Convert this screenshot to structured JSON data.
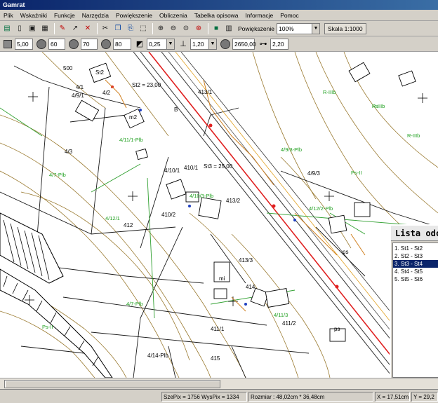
{
  "window": {
    "title": "Gamrat"
  },
  "menu": [
    "Plik",
    "Wskaźniki",
    "Funkcje",
    "Narzędzia",
    "Powiększenie",
    "Obliczenia",
    "Tabelka opisowa",
    "Informacje",
    "Pomoc"
  ],
  "toolbar1": {
    "zoom_label": "Powiększenie",
    "zoom_value": "100%",
    "scale_button": "Skala 1:1000"
  },
  "toolbar2": {
    "f1": "5,00",
    "f2": "60",
    "f3": "70",
    "f4": "80",
    "f5": "0,25",
    "f6": "1,20",
    "f7": "2650,00",
    "f8": "2,20"
  },
  "map_labels": [
    "500",
    "4/1",
    "St2",
    "St2 = 23,00",
    "m2",
    "4/2",
    "4/3",
    "4/10/1",
    "4/9/1",
    "4/9/3",
    "410/1",
    "410/2",
    "411/1",
    "411/2",
    "412",
    "413/1",
    "413/2",
    "413/3",
    "414",
    "415",
    "St3 = 25,00",
    "4/11/1-Plb",
    "4/10/3-Plb",
    "4/9/3-Plb",
    "Ps-II",
    "Ps",
    "ps",
    "4/12/1",
    "4/12/2-Plb",
    "4/11/3",
    "4/14-Plb",
    "4/7-Plb",
    "R-IIIb",
    "B",
    "mi"
  ],
  "list_panel": {
    "title": "Lista odcinków",
    "items": [
      "1. St1 - St2",
      "2. St2 - St3",
      "3. St3 - St4",
      "4. St4 - St5",
      "5. St5 - St6"
    ],
    "selected_index": 2
  },
  "status": {
    "size": "SzePix = 1756 WysPix = 1334",
    "dims": "Rozmiar : 48,02cm * 36,48cm",
    "x": "X = 17,51cm",
    "y": "Y = 29,2"
  },
  "colors": {
    "title_bar": "#0a246a",
    "selected": "#0a246a",
    "contour": "#8a6a20",
    "road": "#e02020",
    "parcel_label": "#20a020"
  }
}
